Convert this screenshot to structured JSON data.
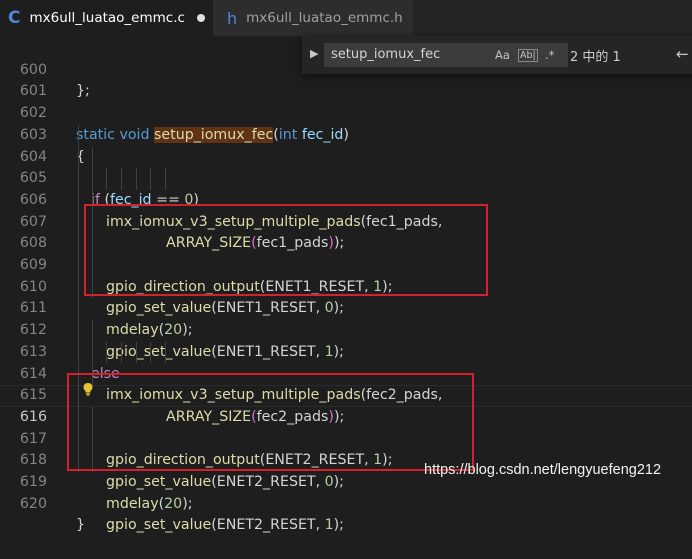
{
  "tabs": [
    {
      "icon": "C",
      "label": "mx6ull_luatao_emmc.c",
      "active": true,
      "modified": true
    },
    {
      "icon": "h",
      "label": "mx6ull_luatao_emmc.h",
      "active": false,
      "modified": false
    }
  ],
  "find": {
    "query": "setup_iomux_fec",
    "match_case": "Aa",
    "whole_word": "Ab|",
    "regex": ".*",
    "result_count": "2 中的 1",
    "prev_arrow": "←"
  },
  "editor": {
    "current_line": "616",
    "lines": [
      {
        "no": "600",
        "text": "};"
      },
      {
        "no": "601",
        "text": ""
      },
      {
        "no": "602",
        "text": "static void setup_iomux_fec(int fec_id)"
      },
      {
        "no": "603",
        "text": "{"
      },
      {
        "no": "604",
        "text": "if (fec_id == 0)"
      },
      {
        "no": "605",
        "text": "imx_iomux_v3_setup_multiple_pads(fec1_pads,"
      },
      {
        "no": "606",
        "text": "ARRAY_SIZE(fec1_pads));"
      },
      {
        "no": "607",
        "text": ""
      },
      {
        "no": "608",
        "text": "gpio_direction_output(ENET1_RESET, 1);"
      },
      {
        "no": "609",
        "text": "gpio_set_value(ENET1_RESET, 0);"
      },
      {
        "no": "610",
        "text": "mdelay(20);"
      },
      {
        "no": "611",
        "text": "gpio_set_value(ENET1_RESET, 1);"
      },
      {
        "no": "612",
        "text": "else"
      },
      {
        "no": "613",
        "text": "imx_iomux_v3_setup_multiple_pads(fec2_pads,"
      },
      {
        "no": "614",
        "text": "ARRAY_SIZE(fec2_pads));"
      },
      {
        "no": "615",
        "text": ""
      },
      {
        "no": "616",
        "text": "gpio_direction_output(ENET2_RESET, 1);"
      },
      {
        "no": "617",
        "text": "gpio_set_value(ENET2_RESET, 0);"
      },
      {
        "no": "618",
        "text": "mdelay(20);"
      },
      {
        "no": "619",
        "text": "gpio_set_value(ENET2_RESET, 1);"
      },
      {
        "no": "620",
        "text": "}"
      }
    ]
  },
  "watermark": "https://blog.csdn.net/lengyuefeng212",
  "colors": {
    "background": "#1e1e1e",
    "keyword": "#569cd6",
    "function": "#dcdcaa",
    "number": "#b5cea8",
    "annotation_box": "#d2222e"
  }
}
